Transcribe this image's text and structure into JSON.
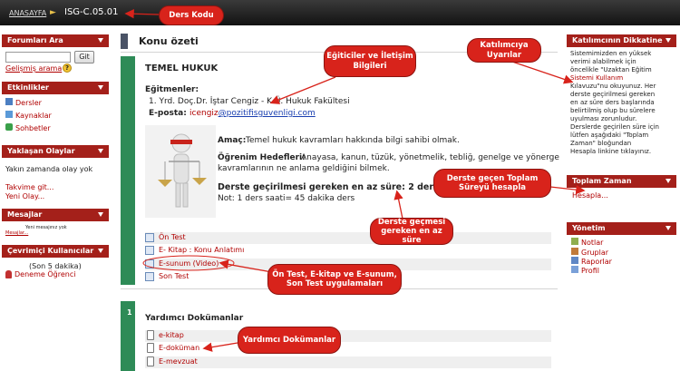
{
  "topbar": {
    "home": "ANASAYFA",
    "arrow": "►",
    "course_code": "ISG-C.05.01"
  },
  "left": {
    "forum_search": {
      "title": "Forumları Ara",
      "go_button": "Git",
      "advanced": "Gelişmiş arama"
    },
    "activities": {
      "title": "Etkinlikler",
      "items": [
        "Dersler",
        "Kaynaklar",
        "Sohbetler"
      ]
    },
    "upcoming": {
      "title": "Yaklaşan Olaylar",
      "empty": "Yakın zamanda olay yok",
      "calendar": "Takvime git...",
      "new_event": "Yeni Olay..."
    },
    "messages": {
      "title": "Mesajlar",
      "none": "Yeni mesajınız yok",
      "link": "Mesajlar..."
    },
    "online": {
      "title": "Çevrimiçi Kullanıcılar",
      "period": "(Son 5 dakika)",
      "user": "Deneme Öğrenci"
    }
  },
  "main": {
    "title": "Konu özeti",
    "course_name": "TEMEL HUKUK",
    "instructors_label": "Eğitmenler:",
    "instructor": "1. Yrd. Doç.Dr. İştar Cengiz - K.Ü. Hukuk Fakültesi",
    "email_label": "E-posta:",
    "email_user": "icengiz",
    "email_domain": "@pozitifisguvenligi.com",
    "aim_label": "Amaç:",
    "aim_text": "Temel hukuk kavramları hakkında bilgi sahibi olmak.",
    "goals_label": "Öğrenim Hedefleri:",
    "goals_line1": "Anayasa, kanun, tüzük, yönetmelik, tebliğ, genelge ve yönerge",
    "goals_line2": "kavramlarının ne anlama geldiğini bilmek.",
    "duration": "Derste geçirilmesi gereken en az süre: 2 ders saati",
    "note": "Not: 1 ders saati= 45 dakika ders",
    "resources": [
      "Ön Test",
      "E- Kitap : Konu Anlatımı",
      "E-sunum (Video)",
      "Son Test"
    ],
    "section_number": "1",
    "section_title": "Yardımcı Dokümanlar",
    "docs": [
      "e-kitap",
      "E-doküman",
      "E-mevzuat"
    ]
  },
  "right": {
    "attention": {
      "title": "Katılımcının Dikkatine",
      "lines": [
        "Sistemimizden en yüksek",
        "verimi alabilmek için",
        "öncelikle \"Uzaktan Eğitim",
        "Sistemi Kullanım",
        "Kılavuzu\"nu okuyunuz. Her",
        "derste geçirilmesi gereken",
        "en az süre ders başlarında",
        "belirtilmiş olup bu sürelere",
        "uyulması zorunludur.",
        "Derslerde geçirilen süre için",
        "lütfen aşağıdaki \"Toplam",
        "Zaman\" bloğundan",
        "Hesapla linkine tıklayınız."
      ]
    },
    "total_time": {
      "title": "Toplam Zaman",
      "link": "Hesapla..."
    },
    "admin": {
      "title": "Yönetim",
      "items": [
        "Notlar",
        "Gruplar",
        "Raporlar",
        "Profil"
      ]
    }
  },
  "callouts": {
    "course_code": "Ders Kodu",
    "instructors": "Eğiticiler ve İletişim Bilgileri",
    "warnings": "Katılımcıya Uyarılar",
    "total_time": "Derste geçen Toplam Süreyü hesapla",
    "min_time": "Derste geçmesi gereken en az süre",
    "tests": "Ön Test, E-kitap ve E-sunum, Son Test uygulamaları",
    "docs": "Yardımcı Dokümanlar"
  },
  "colors": {
    "header_red": "#a4201a",
    "callout_red": "#d8231b",
    "section_green": "#2e8b57",
    "link_red": "#b00000"
  }
}
